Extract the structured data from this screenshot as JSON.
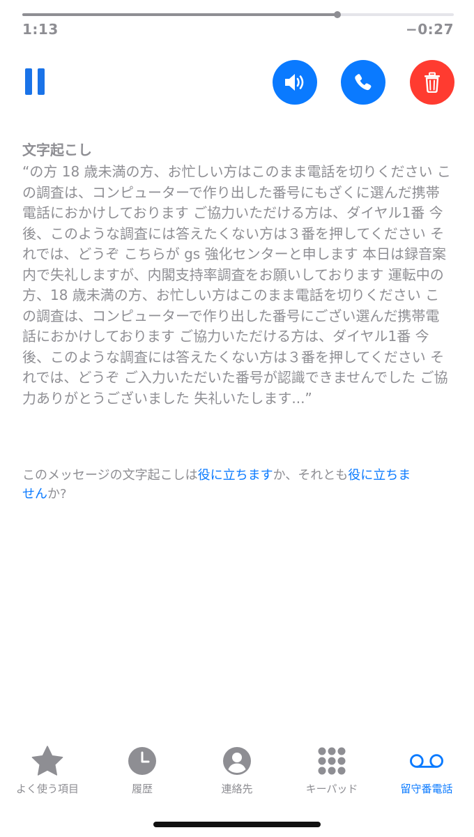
{
  "player": {
    "elapsed": "1:13",
    "remaining": "−0:27",
    "progress": 0.73
  },
  "colors": {
    "accent": "#0a7aff",
    "destructive": "#ff3b30",
    "secondary_text": "#8e8e93"
  },
  "controls": {
    "pause_icon": "pause-icon",
    "speaker_icon": "speaker-icon",
    "call_icon": "phone-icon",
    "delete_icon": "trash-icon"
  },
  "transcript": {
    "title": "文字起こし",
    "text": "“の方 18 歳未満の方、お忙しい方はこのまま電話を切りください この調査は、コンピューターで作り出した番号にもざくに選んだ携帯電話におかけしております ご協力いただける方は、ダイヤル1番 今後、このような調査には答えたくない方は３番を押してください それでは、どうぞ こちらが gs 強化センターと申します 本日は録音案内で失礼しますが、内閣支持率調査をお願いしております 運転中の方、18 歳未満の方、お忙しい方はこのまま電話を切りください この調査は、コンピューターで作り出した番号にござい選んだ携帯電話におかけしております ご協力いただける方は、ダイヤル1番 今後、このような調査には答えたくない方は３番を押してください それでは、どうぞ ご入力いただいた番号が認識できませんでした ご協力ありがとうございました 失礼いたします...”"
  },
  "feedback": {
    "prefix": "このメッセージの文字起こしは",
    "useful_link": "役に立ちます",
    "middle": "か、それとも",
    "not_useful_link": "役に立ちません",
    "suffix": "か?"
  },
  "tabbar": {
    "items": [
      {
        "label": "よく使う項目",
        "icon": "star-icon"
      },
      {
        "label": "履歴",
        "icon": "clock-icon"
      },
      {
        "label": "連絡先",
        "icon": "contact-icon"
      },
      {
        "label": "キーパッド",
        "icon": "keypad-icon"
      },
      {
        "label": "留守番電話",
        "icon": "voicemail-icon",
        "active": true
      }
    ]
  }
}
